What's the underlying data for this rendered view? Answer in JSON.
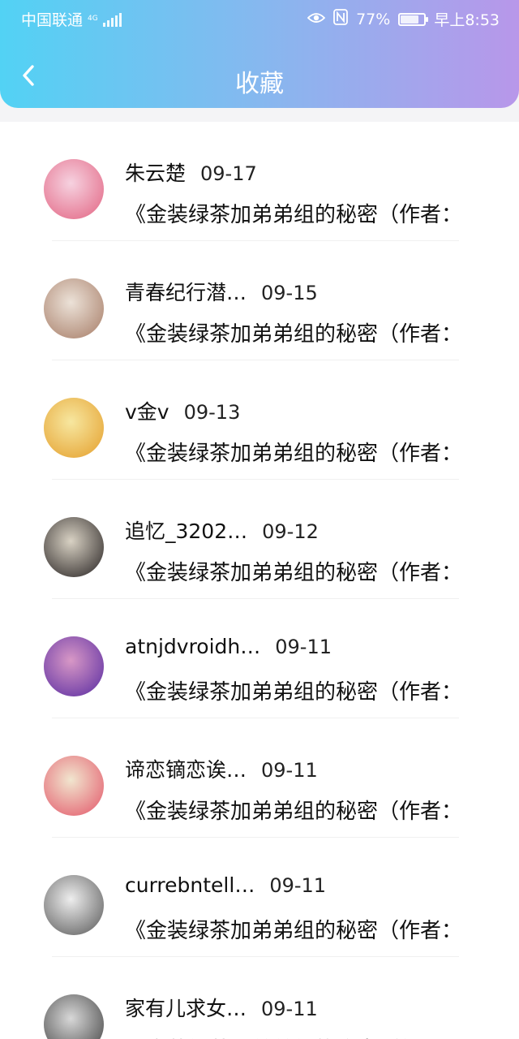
{
  "status": {
    "carrier": "中国联通",
    "net": "4G",
    "battery": "77%",
    "battery_level": 0.77,
    "time": "早上8:53"
  },
  "nav": {
    "title": "收藏"
  },
  "items": [
    {
      "name": "朱云楚",
      "date": "09-17",
      "text": "《金装绿茶加弟弟组的秘密（作者：",
      "avatar_icon": "anime-girl-avatar",
      "avatar_colors": [
        "#f6d2e0",
        "#e5738f"
      ]
    },
    {
      "name": "青春纪行潜…",
      "date": "09-15",
      "text": "《金装绿茶加弟弟组的秘密（作者：",
      "avatar_icon": "portrait-photo-avatar",
      "avatar_colors": [
        "#ece2d8",
        "#b08a76"
      ]
    },
    {
      "name": "v金v",
      "date": "09-13",
      "text": "《金装绿茶加弟弟组的秘密（作者：",
      "avatar_icon": "anime-boy-avatar",
      "avatar_colors": [
        "#f7e7a0",
        "#e7a93c"
      ]
    },
    {
      "name": "追忆_3202…",
      "date": "09-12",
      "text": "《金装绿茶加弟弟组的秘密（作者：",
      "avatar_icon": "christmas-child-avatar",
      "avatar_colors": [
        "#d9d2c4",
        "#3f3a38"
      ]
    },
    {
      "name": "atnjdvroidh…",
      "date": "09-11",
      "text": "《金装绿茶加弟弟组的秘密（作者：",
      "avatar_icon": "lavender-field-avatar",
      "avatar_colors": [
        "#d898c6",
        "#6a3aa6"
      ]
    },
    {
      "name": "谛恋镝恋诶…",
      "date": "09-11",
      "text": "《金装绿茶加弟弟组的秘密（作者：",
      "avatar_icon": "drawing-girl-avatar",
      "avatar_colors": [
        "#f1e6cf",
        "#e56a77"
      ]
    },
    {
      "name": "currebntell…",
      "date": "09-11",
      "text": "《金装绿茶加弟弟组的秘密（作者：",
      "avatar_icon": "husky-puppy-avatar",
      "avatar_colors": [
        "#eeeeee",
        "#6d6d6d"
      ]
    },
    {
      "name": "家有儿求女…",
      "date": "09-11",
      "text": "《金装绿茶加弟弟组的秘密（作者：",
      "avatar_icon": "man-photo-avatar",
      "avatar_colors": [
        "#d8d8d8",
        "#555555"
      ]
    }
  ]
}
